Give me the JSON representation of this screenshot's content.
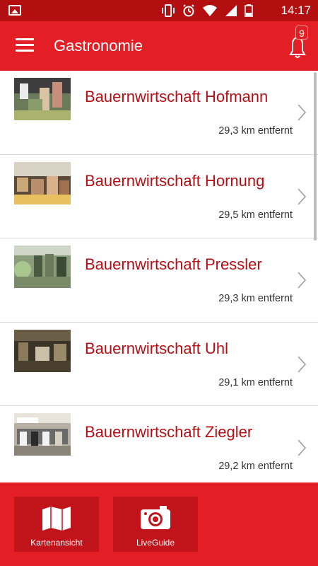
{
  "statusbar": {
    "time": "14:17"
  },
  "appbar": {
    "title": "Gastronomie",
    "notification_count": "9"
  },
  "list": {
    "items": [
      {
        "name": "Bauernwirtschaft Hofmann",
        "distance": "29,3 km entfernt"
      },
      {
        "name": "Bauernwirtschaft Hornung",
        "distance": "29,5 km entfernt"
      },
      {
        "name": "Bauernwirtschaft Pressler",
        "distance": "29,3 km entfernt"
      },
      {
        "name": "Bauernwirtschaft Uhl",
        "distance": "29,1 km entfernt"
      },
      {
        "name": "Bauernwirtschaft Ziegler",
        "distance": "29,2 km entfernt"
      }
    ]
  },
  "bottombar": {
    "map_label": "Kartenansicht",
    "liveguide_label": "LiveGuide"
  },
  "colors": {
    "statusbar": "#b30f10",
    "appbar": "#e31e24",
    "title_text": "#b50f15",
    "tile": "#c0131a"
  }
}
